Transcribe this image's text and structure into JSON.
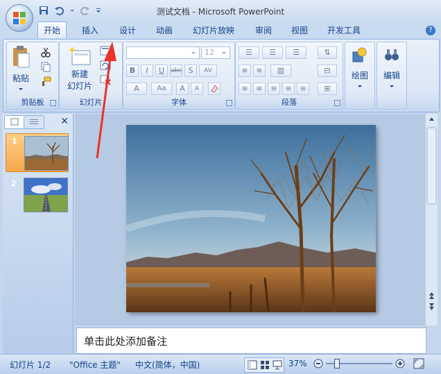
{
  "window": {
    "title": "测试文档 - Microsoft PowerPoint"
  },
  "tabs": [
    {
      "label": "开始"
    },
    {
      "label": "插入"
    },
    {
      "label": "设计"
    },
    {
      "label": "动画"
    },
    {
      "label": "幻灯片放映"
    },
    {
      "label": "审阅"
    },
    {
      "label": "视图"
    },
    {
      "label": "开发工具"
    }
  ],
  "ribbon": {
    "clipboard": {
      "label": "剪贴板",
      "paste": "粘贴"
    },
    "slides": {
      "label": "幻灯片",
      "new_slide_line1": "新建",
      "new_slide_line2": "幻灯片"
    },
    "font": {
      "label": "字体",
      "size_value": "12"
    },
    "paragraph": {
      "label": "段落"
    },
    "drawing": {
      "label": "绘图"
    },
    "editing": {
      "label": "编辑"
    }
  },
  "slides_panel": {
    "slides": [
      {
        "number": "1"
      },
      {
        "number": "2"
      }
    ]
  },
  "notes": {
    "placeholder": "单击此处添加备注"
  },
  "status": {
    "slide_info": "幻灯片 1/2",
    "theme": "\"Office 主题\"",
    "language": "中文(简体，中国)",
    "zoom": "37%"
  },
  "colors": {
    "ribbon_blue": "#c9dbf1",
    "accent": "#15428b",
    "selected_slide": "#f6b14d",
    "annotation_arrow": "#e8322b"
  }
}
